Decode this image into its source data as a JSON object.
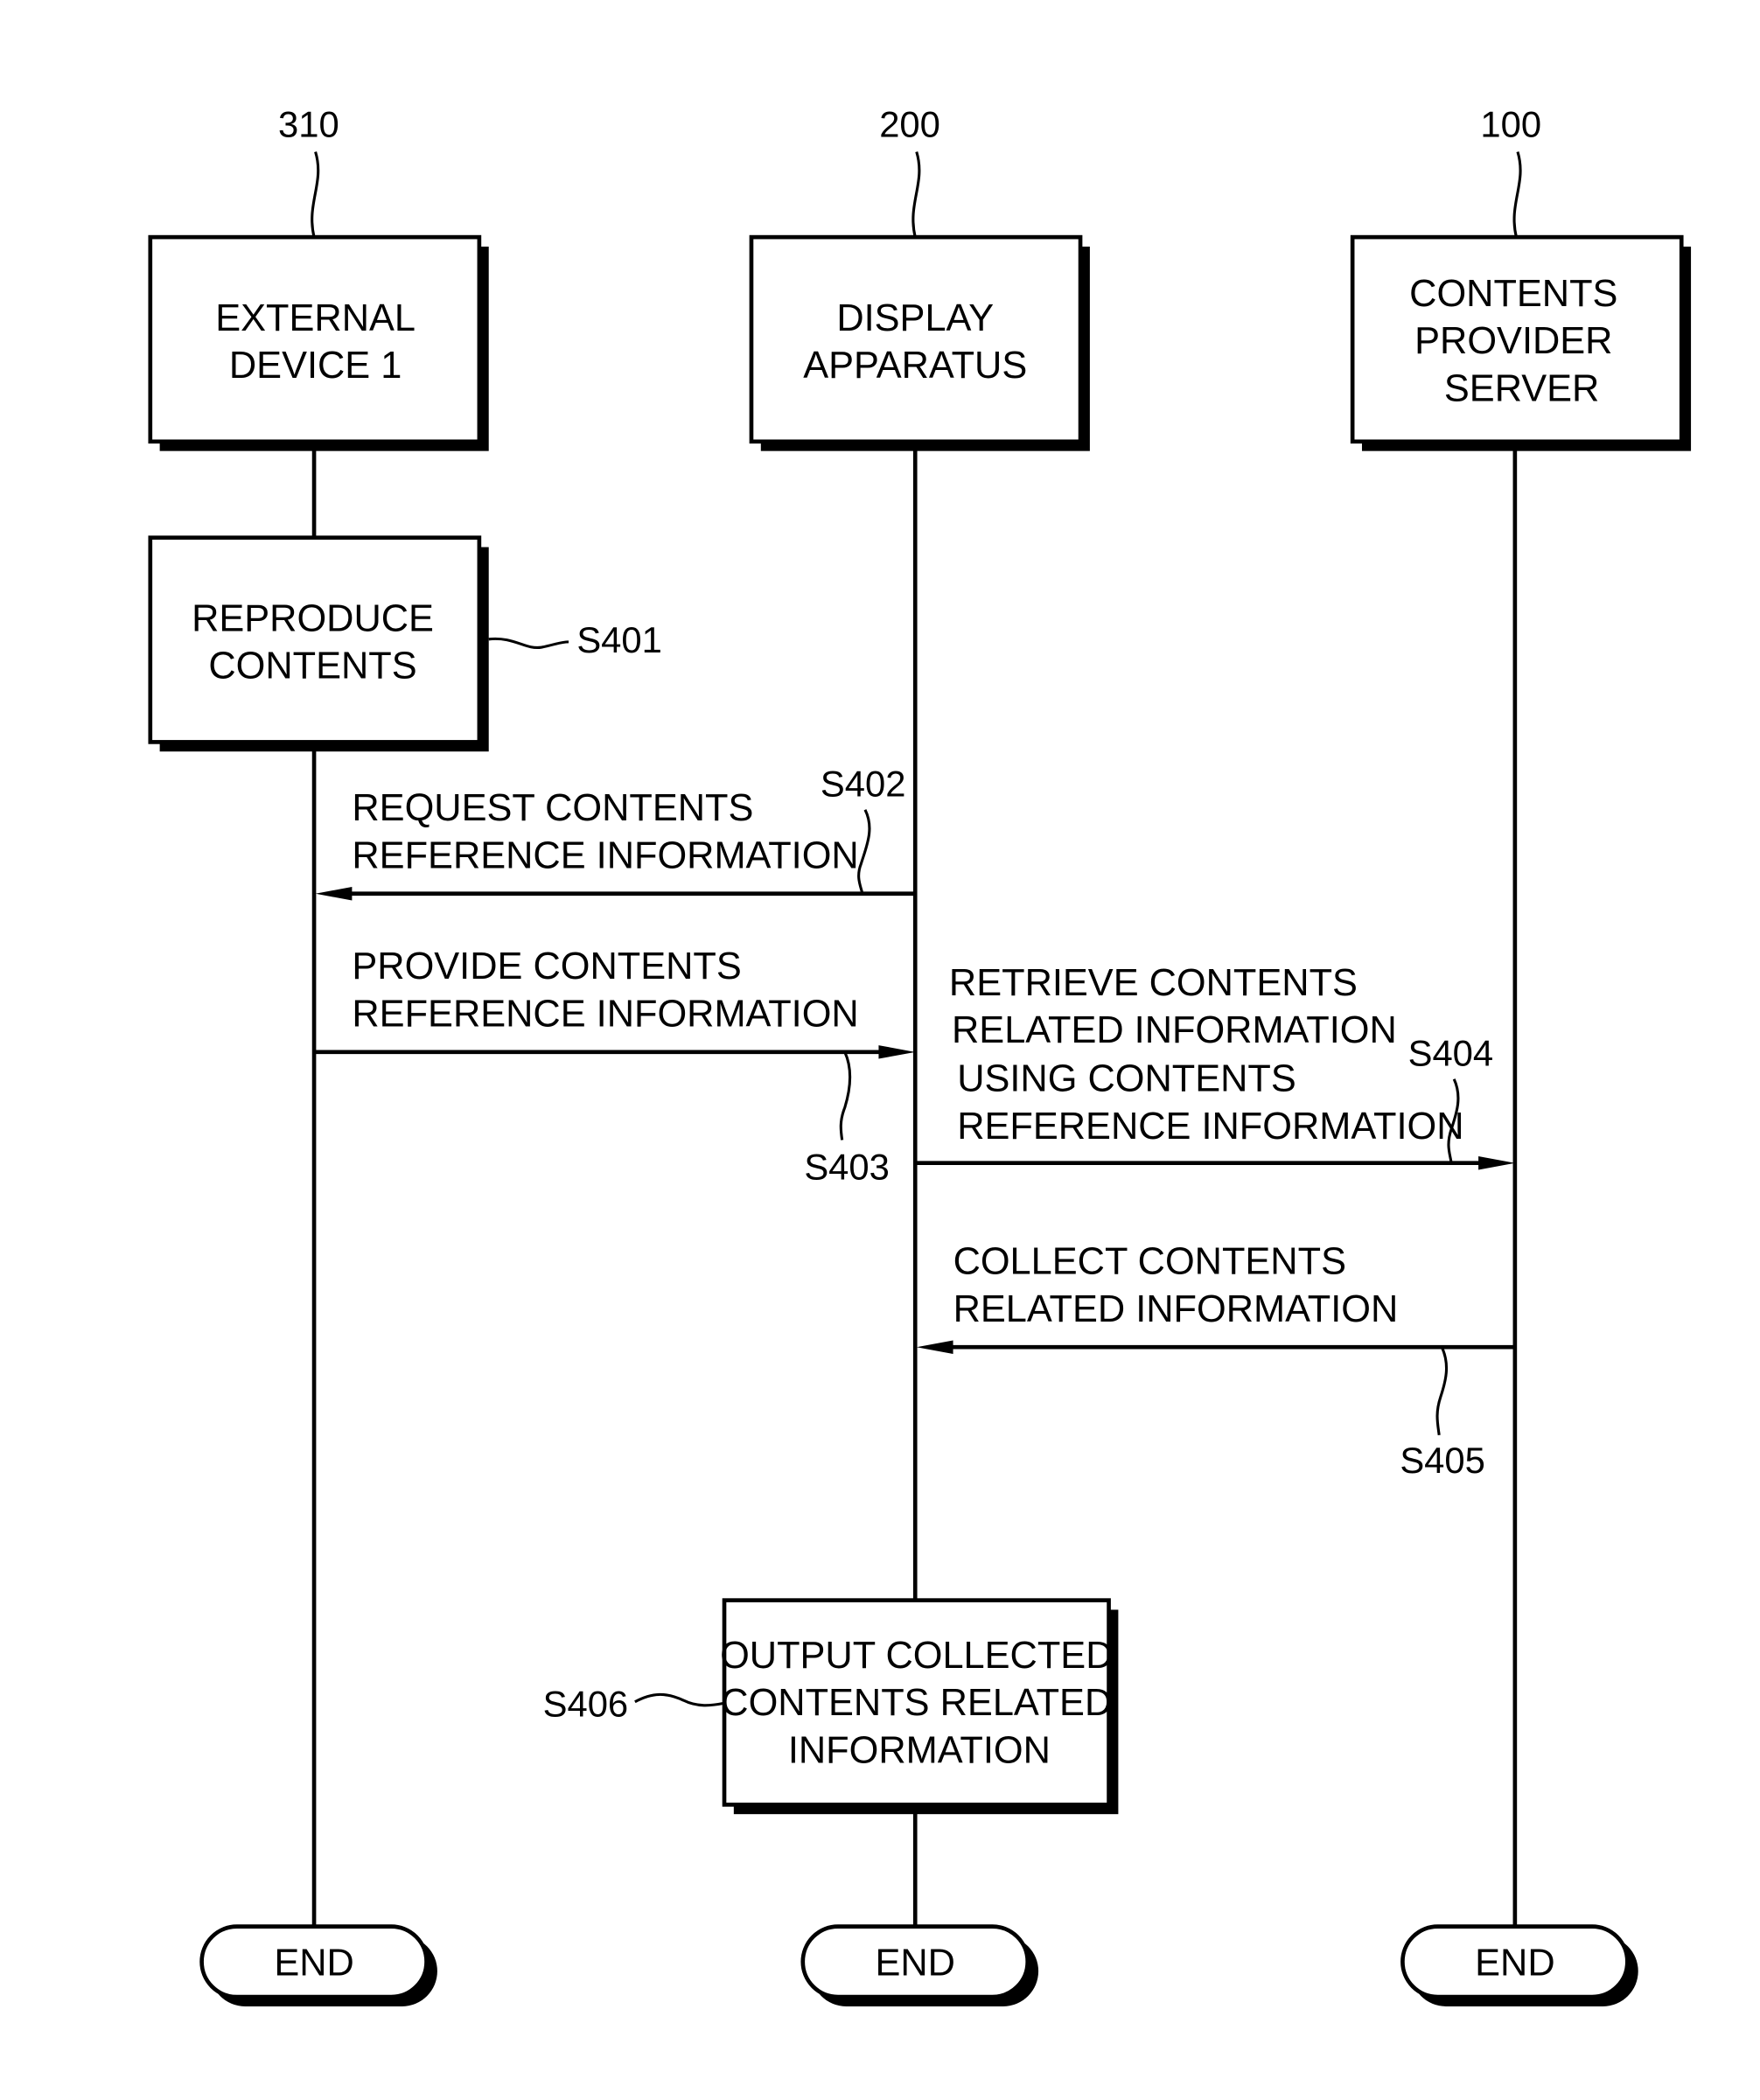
{
  "diagram": {
    "type": "sequence-flowchart",
    "participants": [
      {
        "ref": "310",
        "lines": [
          "EXTERNAL",
          "DEVICE 1"
        ]
      },
      {
        "ref": "200",
        "lines": [
          "DISPLAY",
          "APPARATUS"
        ]
      },
      {
        "ref": "100",
        "lines": [
          "CONTENTS",
          "PROVIDER",
          "SERVER"
        ]
      }
    ],
    "steps": {
      "s401": {
        "id": "S401",
        "lines": [
          "REPRODUCE",
          "CONTENTS"
        ],
        "participant": "310"
      },
      "s402": {
        "id": "S402",
        "lines": [
          "REQUEST CONTENTS",
          "REFERENCE INFORMATION"
        ],
        "from": "200",
        "to": "310"
      },
      "s403": {
        "id": "S403",
        "lines": [
          "PROVIDE CONTENTS",
          "REFERENCE INFORMATION"
        ],
        "from": "310",
        "to": "200"
      },
      "s404": {
        "id": "S404",
        "lines": [
          "RETRIEVE CONTENTS",
          "RELATED INFORMATION",
          "USING CONTENTS",
          "REFERENCE INFORMATION"
        ],
        "from": "200",
        "to": "100"
      },
      "s405": {
        "id": "S405",
        "lines": [
          "COLLECT CONTENTS",
          "RELATED INFORMATION"
        ],
        "from": "100",
        "to": "200"
      },
      "s406": {
        "id": "S406",
        "lines": [
          "OUTPUT COLLECTED",
          "CONTENTS RELATED",
          "INFORMATION"
        ],
        "participant": "200"
      }
    },
    "end_label": "END"
  }
}
